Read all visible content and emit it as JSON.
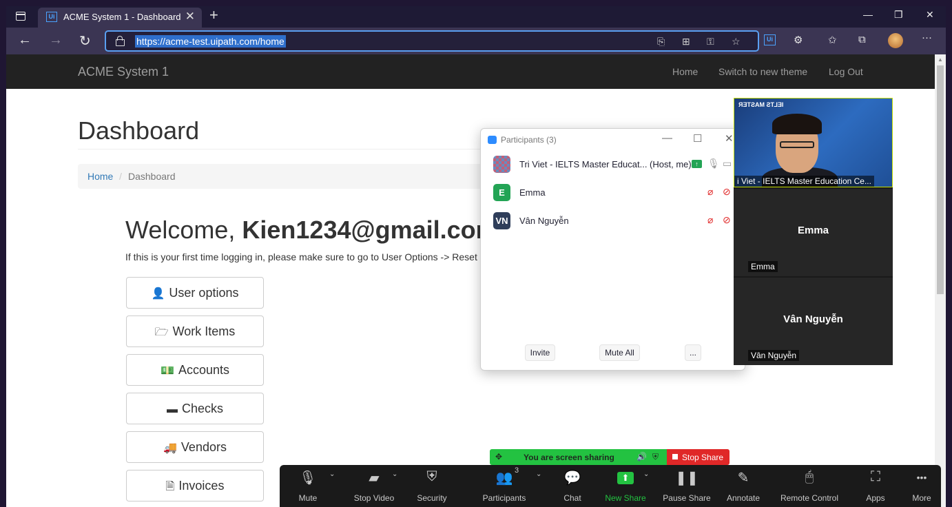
{
  "browser": {
    "tab_title": "ACME System 1 - Dashboard",
    "tab_close": "✕",
    "new_tab": "+",
    "favicon": "Ui",
    "url": "https://acme-test.uipath.com/home",
    "minimize": "—",
    "restore": "❐",
    "close": "✕",
    "back": "←",
    "forward": "→",
    "reload": "↻",
    "more": "···"
  },
  "navbar": {
    "brand": "ACME System 1",
    "links": [
      "Home",
      "Switch to new theme",
      "Log Out"
    ]
  },
  "page": {
    "title": "Dashboard",
    "breadcrumb": {
      "home": "Home",
      "sep": "/",
      "current": "Dashboard"
    },
    "welcome_prefix": "Welcome, ",
    "welcome_user": "Kien1234@gmail.com",
    "first_time_text": "If this is your first time logging in, please make sure to go to User Options -> Reset",
    "menu": [
      {
        "label": "User options",
        "icon": "user-icon",
        "glyph": "👤"
      },
      {
        "label": "Work Items",
        "icon": "folder-open-icon",
        "glyph": "🗁"
      },
      {
        "label": "Accounts",
        "icon": "money-icon",
        "glyph": "💵"
      },
      {
        "label": "Checks",
        "icon": "credit-card-icon",
        "glyph": "▬"
      },
      {
        "label": "Vendors",
        "icon": "truck-icon",
        "glyph": "🚚"
      },
      {
        "label": "Invoices",
        "icon": "file-text-icon",
        "glyph": "🗎"
      }
    ]
  },
  "participants": {
    "title": "Participants (3)",
    "list": [
      {
        "name": "Tri Viet - IELTS Master Educat... (Host, me)",
        "avatar": "",
        "color": "#c0607a"
      },
      {
        "name": "Emma",
        "avatar": "E",
        "color": "#23a455"
      },
      {
        "name": "Vân Nguyễn",
        "avatar": "VN",
        "color": "#2f3e5a"
      }
    ],
    "buttons": {
      "invite": "Invite",
      "mute_all": "Mute All",
      "more": "..."
    }
  },
  "videos": {
    "self_logo": "IELTS MASTER",
    "self_label": "i Viet - IELTS Master Education Ce...",
    "tiles": [
      {
        "name": "Emma",
        "label": "Emma"
      },
      {
        "name": "Vân Nguyễn",
        "label": "Vân Nguyễn"
      }
    ]
  },
  "zoom": {
    "sharing_text": "You are screen sharing",
    "stop_share": "Stop Share",
    "participant_count": "3",
    "toolbar": [
      {
        "label": "Mute",
        "icon": "microphone-icon",
        "glyph": "🎙"
      },
      {
        "label": "Stop Video",
        "icon": "video-camera-icon",
        "glyph": "▰"
      },
      {
        "label": "Security",
        "icon": "shield-icon",
        "glyph": "⛨"
      },
      {
        "label": "Participants",
        "icon": "participants-icon",
        "glyph": "👥"
      },
      {
        "label": "Chat",
        "icon": "chat-icon",
        "glyph": "💬"
      },
      {
        "label": "New Share",
        "icon": "share-screen-icon",
        "glyph": "⬆"
      },
      {
        "label": "Pause Share",
        "icon": "pause-icon",
        "glyph": "❚❚"
      },
      {
        "label": "Annotate",
        "icon": "pencil-icon",
        "glyph": "✎"
      },
      {
        "label": "Remote Control",
        "icon": "mouse-icon",
        "glyph": "🖱"
      },
      {
        "label": "Apps",
        "icon": "apps-icon",
        "glyph": "⛶"
      },
      {
        "label": "More",
        "icon": "more-icon",
        "glyph": "•••"
      }
    ]
  },
  "colors": {
    "accent": "#337ab7",
    "zoom_green": "#23c241",
    "zoom_red": "#e02828",
    "navbar": "#222222"
  }
}
